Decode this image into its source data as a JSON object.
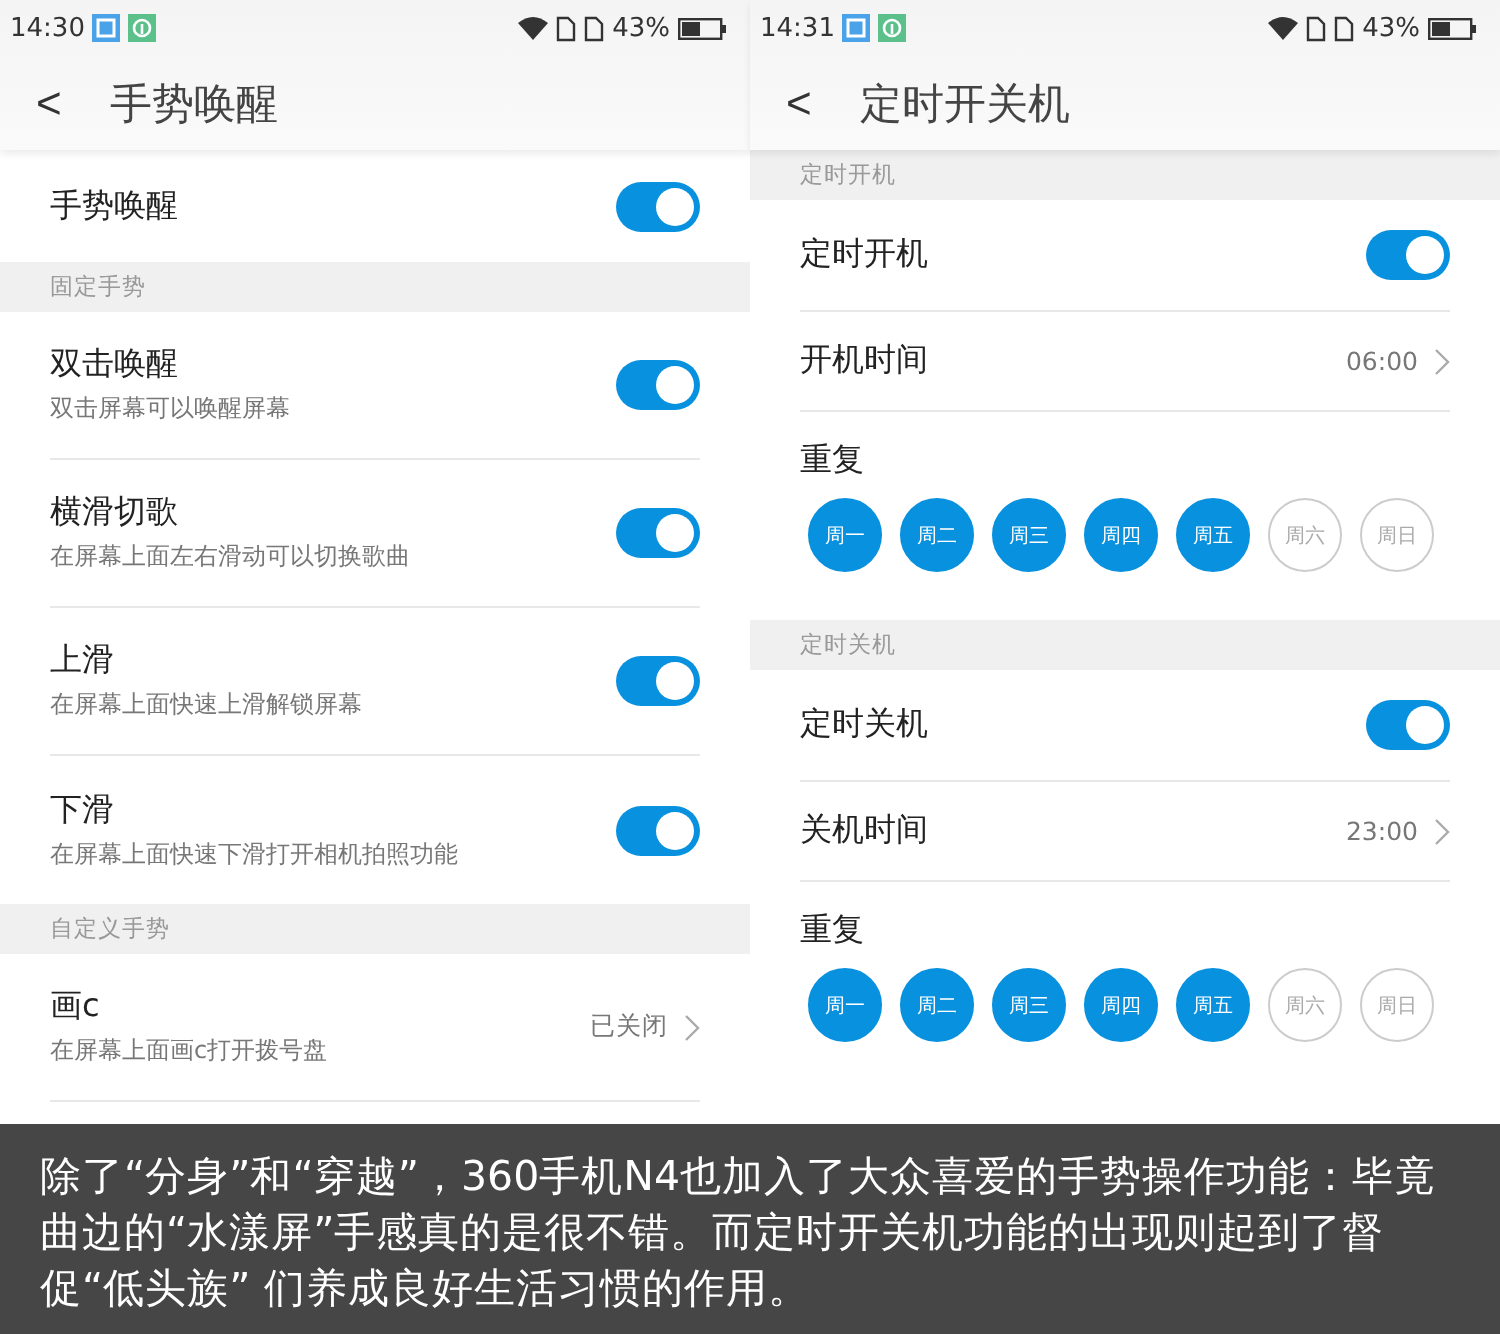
{
  "screens": [
    {
      "status_bar": {
        "time": "14:30",
        "battery": "43%"
      },
      "title": "手势唤醒",
      "back": "<",
      "sections": [
        {
          "rows": [
            {
              "kind": "switch",
              "title": "手势唤醒",
              "on": true
            }
          ]
        },
        {
          "header": "固定手势",
          "rows": [
            {
              "kind": "switch",
              "title": "双击唤醒",
              "subtitle": "双击屏幕可以唤醒屏幕",
              "on": true
            },
            {
              "kind": "switch",
              "title": "横滑切歌",
              "subtitle": "在屏幕上面左右滑动可以切换歌曲",
              "on": true
            },
            {
              "kind": "switch",
              "title": "上滑",
              "subtitle": "在屏幕上面快速上滑解锁屏幕",
              "on": true
            },
            {
              "kind": "switch",
              "title": "下滑",
              "subtitle": "在屏幕上面快速下滑打开相机拍照功能",
              "on": true
            }
          ]
        },
        {
          "header": "自定义手势",
          "rows": [
            {
              "kind": "link",
              "title": "画c",
              "subtitle": "在屏幕上面画c打开拨号盘",
              "value": "已关闭"
            }
          ]
        }
      ]
    },
    {
      "status_bar": {
        "time": "14:31",
        "battery": "43%"
      },
      "title": "定时开关机",
      "back": "<",
      "sections": [
        {
          "header": "定时开机",
          "rows": [
            {
              "kind": "switch",
              "title": "定时开机",
              "on": true
            },
            {
              "kind": "link",
              "title": "开机时间",
              "value": "06:00"
            },
            {
              "kind": "days",
              "title": "重复",
              "days": [
                {
                  "label": "周一",
                  "selected": true
                },
                {
                  "label": "周二",
                  "selected": true
                },
                {
                  "label": "周三",
                  "selected": true
                },
                {
                  "label": "周四",
                  "selected": true
                },
                {
                  "label": "周五",
                  "selected": true
                },
                {
                  "label": "周六",
                  "selected": false
                },
                {
                  "label": "周日",
                  "selected": false
                }
              ]
            }
          ]
        },
        {
          "header": "定时关机",
          "rows": [
            {
              "kind": "switch",
              "title": "定时关机",
              "on": true
            },
            {
              "kind": "link",
              "title": "关机时间",
              "value": "23:00"
            },
            {
              "kind": "days",
              "title": "重复",
              "days": [
                {
                  "label": "周一",
                  "selected": true
                },
                {
                  "label": "周二",
                  "selected": true
                },
                {
                  "label": "周三",
                  "selected": true
                },
                {
                  "label": "周四",
                  "selected": true
                },
                {
                  "label": "周五",
                  "selected": true
                },
                {
                  "label": "周六",
                  "selected": false
                },
                {
                  "label": "周日",
                  "selected": false
                }
              ]
            }
          ]
        }
      ]
    }
  ],
  "caption": "除了“分身”和“穿越”，360手机N4也加入了大众喜爱的手势操作功能：毕竟曲边的“水漾屏”手感真的是很不错。而定时开关机功能的出现则起到了督促“低头族” 们养成良好生活习惯的作用。"
}
